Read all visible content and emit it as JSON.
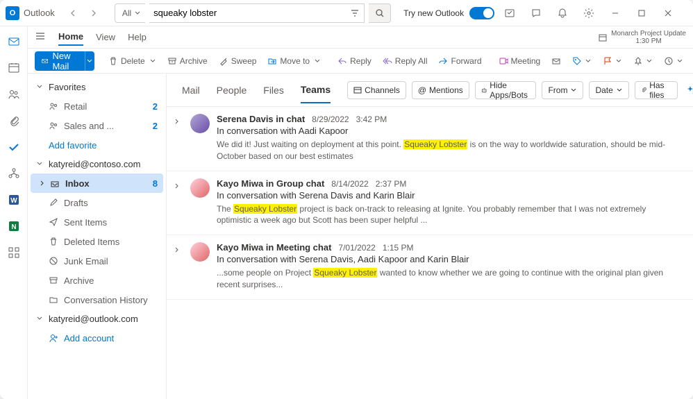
{
  "app": {
    "name": "Outlook"
  },
  "search": {
    "scope_label": "All",
    "query": "squeaky lobster"
  },
  "try_new": {
    "label": "Try new Outlook"
  },
  "meta": {
    "title": "Monarch Project Update",
    "time": "1:30 PM"
  },
  "tabs": {
    "home": "Home",
    "view": "View",
    "help": "Help"
  },
  "ribbon": {
    "new_mail": "New Mail",
    "delete": "Delete",
    "archive": "Archive",
    "sweep": "Sweep",
    "move_to": "Move to",
    "reply": "Reply",
    "reply_all": "Reply All",
    "forward": "Forward",
    "meeting": "Meeting"
  },
  "folders": {
    "favorites": "Favorites",
    "fav_items": [
      {
        "label": "Retail",
        "count": "2"
      },
      {
        "label": "Sales and ...",
        "count": "2"
      }
    ],
    "add_favorite": "Add favorite",
    "account1": "katyreid@contoso.com",
    "inbox": {
      "label": "Inbox",
      "count": "8"
    },
    "items": [
      {
        "label": "Drafts"
      },
      {
        "label": "Sent Items"
      },
      {
        "label": "Deleted Items"
      },
      {
        "label": "Junk Email"
      },
      {
        "label": "Archive"
      },
      {
        "label": "Conversation History"
      }
    ],
    "account2": "katyreid@outlook.com",
    "add_account": "Add account"
  },
  "scopes": {
    "mail": "Mail",
    "people": "People",
    "files": "Files",
    "teams": "Teams"
  },
  "filters": {
    "channels": "Channels",
    "mentions": "Mentions",
    "hide": "Hide Apps/Bots",
    "from": "From",
    "date": "Date",
    "has_files": "Has files"
  },
  "messages": [
    {
      "from": "Serena Davis in chat",
      "date": "8/29/2022",
      "time": "3:42 PM",
      "subject": "In conversation with Aadi Kapoor",
      "preview_a": "We did it! Just waiting on deployment at this point. ",
      "hl": "Squeaky Lobster",
      "preview_b": " is on the way to worldwide saturation, should be mid-October based on our best estimates"
    },
    {
      "from": "Kayo Miwa in Group chat",
      "date": "8/14/2022",
      "time": "2:37 PM",
      "subject": "In conversation with Serena Davis and Karin Blair",
      "preview_a": "The ",
      "hl": "Squeaky Lobster",
      "preview_b": " project is back on-track to releasing at Ignite. You probably remember that I was not extremely optimistic a week ago but Scott has been super helpful ..."
    },
    {
      "from": "Kayo Miwa in Meeting chat",
      "date": "7/01/2022",
      "time": "1:15 PM",
      "subject": "In conversation with Serena Davis, Aadi Kapoor and Karin Blair",
      "preview_a": "...some people on Project ",
      "hl": "Squeaky Lobster",
      "preview_b": " wanted to know whether we are going to continue with the original plan given recent surprises..."
    }
  ]
}
